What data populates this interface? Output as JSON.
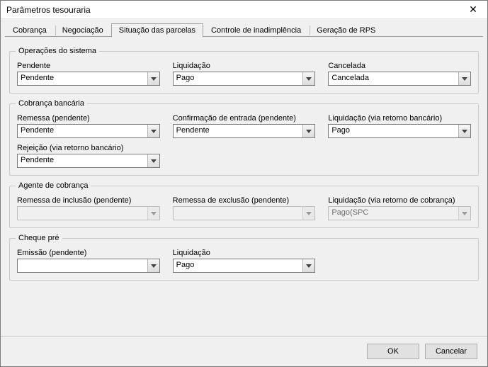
{
  "window": {
    "title": "Parâmetros tesouraria"
  },
  "tabs": [
    {
      "label": "Cobrança"
    },
    {
      "label": "Negociação"
    },
    {
      "label": "Situação das parcelas"
    },
    {
      "label": "Controle de inadimplência"
    },
    {
      "label": "Geração de RPS"
    }
  ],
  "groups": {
    "ops": {
      "legend": "Operações do sistema",
      "pendente": {
        "label": "Pendente",
        "value": "Pendente"
      },
      "liquidacao": {
        "label": "Liquidação",
        "value": "Pago"
      },
      "cancelada": {
        "label": "Cancelada",
        "value": "Cancelada"
      }
    },
    "cob": {
      "legend": "Cobrança bancária",
      "remessa": {
        "label": "Remessa (pendente)",
        "value": "Pendente"
      },
      "confirmacao": {
        "label": "Confirmação de entrada (pendente)",
        "value": "Pendente"
      },
      "liquidacao": {
        "label": "Liquidação (via retorno bancário)",
        "value": "Pago"
      },
      "rejeicao": {
        "label": "Rejeição (via retorno bancário)",
        "value": "Pendente"
      }
    },
    "agente": {
      "legend": "Agente de cobrança",
      "rem_inclusao": {
        "label": "Remessa de inclusão (pendente)",
        "value": ""
      },
      "rem_exclusao": {
        "label": "Remessa de exclusão (pendente)",
        "value": ""
      },
      "liquidacao": {
        "label": "Liquidação (via retorno de cobrança)",
        "value": "Pago(SPC"
      }
    },
    "cheque": {
      "legend": "Cheque pré",
      "emissao": {
        "label": "Emissão (pendente)",
        "value": ""
      },
      "liquidacao": {
        "label": "Liquidação",
        "value": "Pago"
      }
    }
  },
  "footer": {
    "ok": "OK",
    "cancel": "Cancelar"
  }
}
